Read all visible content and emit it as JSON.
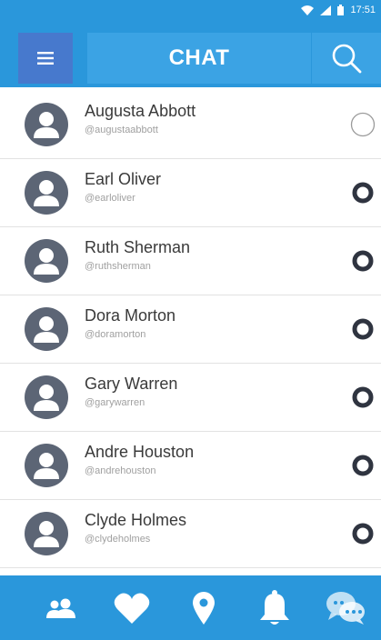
{
  "status_bar": {
    "time": "17:51",
    "icons": [
      "wifi-icon",
      "signal-icon",
      "battery-icon"
    ]
  },
  "app_bar": {
    "title": "CHAT",
    "menu_icon": "hamburger-menu-icon",
    "search_icon": "search-icon"
  },
  "contacts": [
    {
      "name": "Augusta Abbott",
      "handle": "@augustaabbott",
      "selected": false,
      "style": "outline"
    },
    {
      "name": "Earl Oliver",
      "handle": "@earloliver",
      "selected": false,
      "style": "bold"
    },
    {
      "name": "Ruth Sherman",
      "handle": "@ruthsherman",
      "selected": false,
      "style": "bold"
    },
    {
      "name": "Dora Morton",
      "handle": "@doramorton",
      "selected": false,
      "style": "bold"
    },
    {
      "name": "Gary Warren",
      "handle": "@garywarren",
      "selected": false,
      "style": "bold"
    },
    {
      "name": "Andre Houston",
      "handle": "@andrehouston",
      "selected": false,
      "style": "bold"
    },
    {
      "name": "Clyde Holmes",
      "handle": "@clydeholmes",
      "selected": false,
      "style": "bold"
    }
  ],
  "bottom_nav": [
    "people-icon",
    "heart-icon",
    "map-pin-icon",
    "bell-icon",
    "chat-bubbles-icon"
  ],
  "colors": {
    "primary": "#2a97db",
    "primary_light": "#3ba3e4",
    "menu_button": "#4779cd",
    "avatar": "#5c6575",
    "text_dark": "#3a3a3a",
    "text_muted": "#a0a0a0"
  }
}
